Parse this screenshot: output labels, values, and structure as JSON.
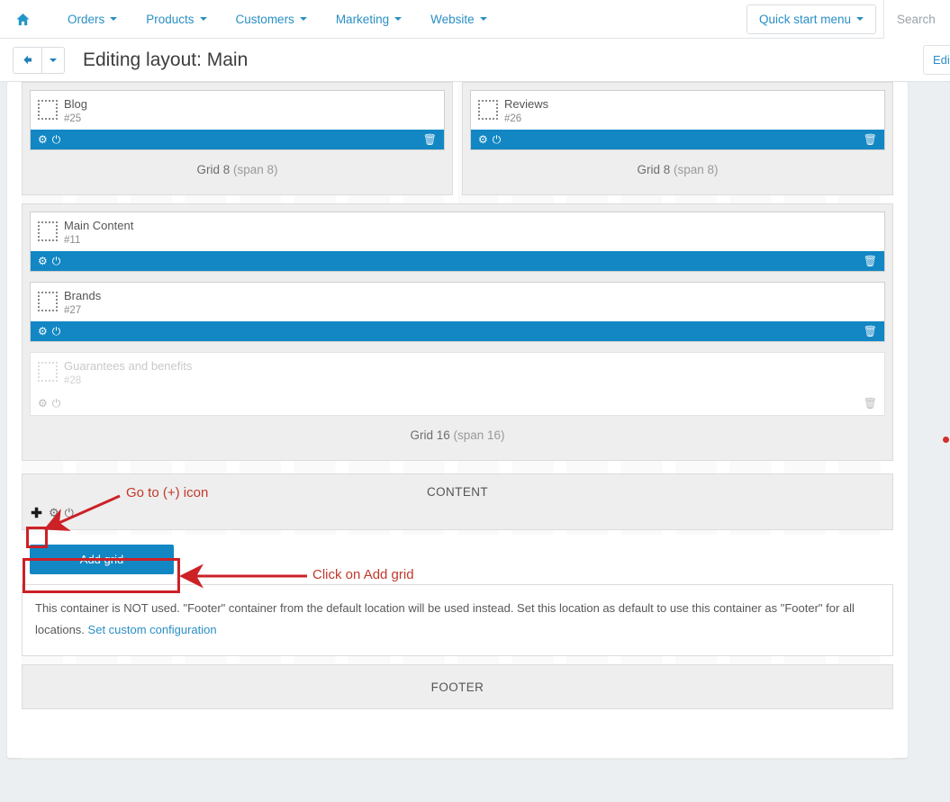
{
  "topnav": {
    "home_icon": "home-icon",
    "items": [
      {
        "label": "Orders",
        "icon": "chevron-down-icon"
      },
      {
        "label": "Products",
        "icon": "chevron-down-icon"
      },
      {
        "label": "Customers",
        "icon": "chevron-down-icon"
      },
      {
        "label": "Marketing",
        "icon": "chevron-down-icon"
      },
      {
        "label": "Website",
        "icon": "chevron-down-icon"
      }
    ],
    "quick_start_label": "Quick start menu",
    "search_placeholder": "Search"
  },
  "subheader": {
    "back_icon": "arrow-left-icon",
    "back_caret_icon": "chevron-down-icon",
    "title": "Editing layout: Main",
    "edit_button_label": "Edi"
  },
  "layout": {
    "top_row": [
      {
        "block": {
          "name": "Blog",
          "id": "#25",
          "settings_icon": "gear-icon",
          "power_icon": "power-icon",
          "delete_icon": "trash-icon"
        },
        "grid_label": "Grid 8",
        "grid_span": "(span 8)"
      },
      {
        "block": {
          "name": "Reviews",
          "id": "#26",
          "settings_icon": "gear-icon",
          "power_icon": "power-icon",
          "delete_icon": "trash-icon"
        },
        "grid_label": "Grid 8",
        "grid_span": "(span 8)"
      }
    ],
    "main_grid": {
      "blocks": [
        {
          "name": "Main Content",
          "id": "#11",
          "settings_icon": "gear-icon",
          "power_icon": "power-icon",
          "delete_icon": "trash-icon",
          "disabled": false
        },
        {
          "name": "Brands",
          "id": "#27",
          "settings_icon": "gear-icon",
          "power_icon": "power-icon",
          "delete_icon": "trash-icon",
          "disabled": false
        },
        {
          "name": "Guarantees and benefits",
          "id": "#28",
          "settings_icon": "gear-icon",
          "power_icon": "power-icon",
          "delete_icon": "trash-icon",
          "disabled": true
        }
      ],
      "grid_label": "Grid 16",
      "grid_span": "(span 16)"
    },
    "content_container": {
      "title": "CONTENT",
      "add_icon": "plus-icon",
      "settings_icon": "gear-icon",
      "power_icon": "power-icon"
    },
    "add_grid_button_label": "Add grid",
    "footer_notice": {
      "text": "This container is NOT used. \"Footer\" container from the default location will be used instead. Set this location as default to use this container as \"Footer\" for all locations.",
      "link_label": "Set custom configuration"
    },
    "footer_container": {
      "title": "FOOTER"
    }
  },
  "annotations": [
    {
      "text": "Go to (+) icon",
      "color": "#c0392b"
    },
    {
      "text": "Click on Add grid",
      "color": "#c0392b"
    }
  ],
  "colors": {
    "accent_blue": "#1287c4",
    "nav_link": "#2a8fc4",
    "annotation_red": "#c0392b",
    "highlight_box": "#cc2127",
    "page_bg": "#eceff1",
    "container_bg": "#eeeeee"
  }
}
